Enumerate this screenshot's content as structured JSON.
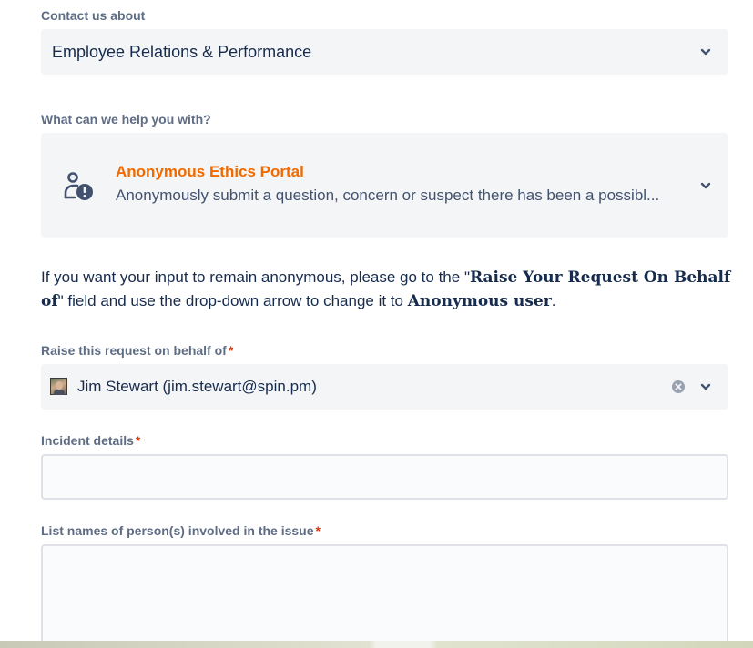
{
  "contact": {
    "label": "Contact us about",
    "value": "Employee Relations & Performance",
    "icon": "chevron-down-icon"
  },
  "help": {
    "label": "What can we help you with?",
    "title": "Anonymous Ethics Portal",
    "description": "Anonymously submit a question, concern or suspect there has been a possibl...",
    "icon": "anonymous-person-alert-icon"
  },
  "info": {
    "part1": "If you want your input to remain anonymous, please go to the \"",
    "bold1": "Raise Your Request On Behalf of",
    "part2": "\" field and use the drop-down arrow to change it to ",
    "bold2": "Anonymous user",
    "part3": "."
  },
  "behalf": {
    "label": "Raise this request on behalf of",
    "required_mark": "*",
    "value": "Jim Stewart (jim.stewart@spin.pm)"
  },
  "incident": {
    "label": "Incident details",
    "required_mark": "*",
    "value": ""
  },
  "persons": {
    "label": "List names of person(s) involved in the issue",
    "required_mark": "*",
    "value": ""
  },
  "colors": {
    "accent_orange": "#f06a00",
    "required_red": "#de350b",
    "field_bg": "#f4f5f7"
  }
}
